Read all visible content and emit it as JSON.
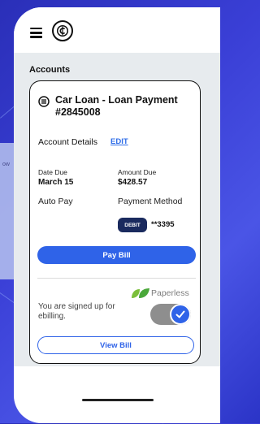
{
  "background": {
    "side_label": "ow"
  },
  "header": {
    "menu_icon": "hamburger-icon",
    "logo_icon": "coin-logo-icon"
  },
  "accounts": {
    "title": "Accounts",
    "card": {
      "icon": "document-icon",
      "title": "Car Loan - Loan Payment #2845008",
      "account_details_label": "Account Details",
      "edit_label": "EDIT",
      "date_due_label": "Date Due",
      "date_due_value": "March 15",
      "amount_due_label": "Amount Due",
      "amount_due_value": "$428.57",
      "auto_pay_label": "Auto Pay",
      "payment_method_label": "Payment Method",
      "payment_badge": "DEBIT",
      "payment_account": "**3395",
      "pay_button": "Pay Bill",
      "paperless_label": "Paperless",
      "paperless_status": "You are signed up for ebilling.",
      "paperless_enabled": true,
      "view_button": "View Bill"
    }
  },
  "colors": {
    "accent": "#2f63e8",
    "badge": "#1a2a5e",
    "background": "#3a3fd6"
  }
}
